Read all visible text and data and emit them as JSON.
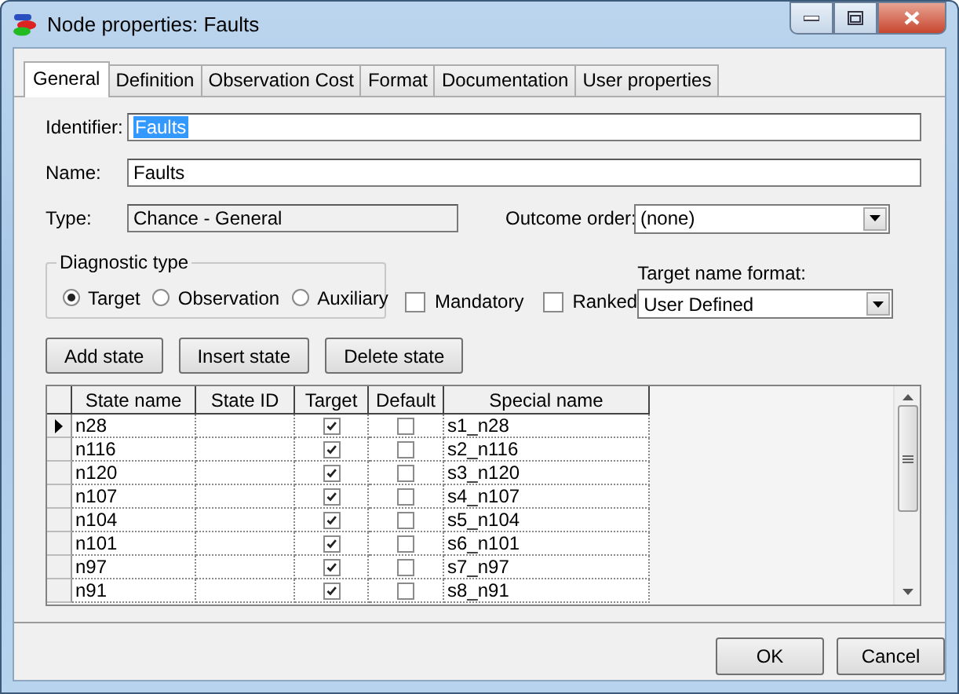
{
  "window": {
    "title": "Node properties: Faults"
  },
  "tabs": [
    {
      "label": "General",
      "selected": true
    },
    {
      "label": "Definition",
      "selected": false
    },
    {
      "label": "Observation Cost",
      "selected": false
    },
    {
      "label": "Format",
      "selected": false
    },
    {
      "label": "Documentation",
      "selected": false
    },
    {
      "label": "User properties",
      "selected": false
    }
  ],
  "identifier": {
    "label": "Identifier:",
    "value": "Faults",
    "text_selected": true
  },
  "name": {
    "label": "Name:",
    "value": "Faults"
  },
  "type": {
    "label": "Type:",
    "value": "Chance - General"
  },
  "outcome_order": {
    "label": "Outcome order:",
    "value": "(none)"
  },
  "diagnostic_type": {
    "title": "Diagnostic type",
    "options": [
      {
        "label": "Target",
        "selected": true
      },
      {
        "label": "Observation",
        "selected": false
      },
      {
        "label": "Auxiliary",
        "selected": false
      }
    ]
  },
  "mandatory": {
    "label": "Mandatory",
    "checked": false
  },
  "ranked": {
    "label": "Ranked",
    "checked": false
  },
  "target_name_format": {
    "label": "Target name format:",
    "value": "User Defined"
  },
  "state_buttons": [
    "Add state",
    "Insert state",
    "Delete state"
  ],
  "grid": {
    "columns": [
      "State name",
      "State ID",
      "Target",
      "Default",
      "Special name"
    ],
    "rows": [
      {
        "current": true,
        "state_name": "n28",
        "target": true,
        "default": false,
        "special_name": "s1_n28"
      },
      {
        "current": false,
        "state_name": "n116",
        "target": true,
        "default": false,
        "special_name": "s2_n116"
      },
      {
        "current": false,
        "state_name": "n120",
        "target": true,
        "default": false,
        "special_name": "s3_n120"
      },
      {
        "current": false,
        "state_name": "n107",
        "target": true,
        "default": false,
        "special_name": "s4_n107"
      },
      {
        "current": false,
        "state_name": "n104",
        "target": true,
        "default": false,
        "special_name": "s5_n104"
      },
      {
        "current": false,
        "state_name": "n101",
        "target": true,
        "default": false,
        "special_name": "s6_n101"
      },
      {
        "current": false,
        "state_name": "n97",
        "target": true,
        "default": false,
        "special_name": "s7_n97"
      },
      {
        "current": false,
        "state_name": "n91",
        "target": true,
        "default": false,
        "special_name": "s8_n91"
      }
    ]
  },
  "footer_buttons": [
    "OK",
    "Cancel"
  ]
}
